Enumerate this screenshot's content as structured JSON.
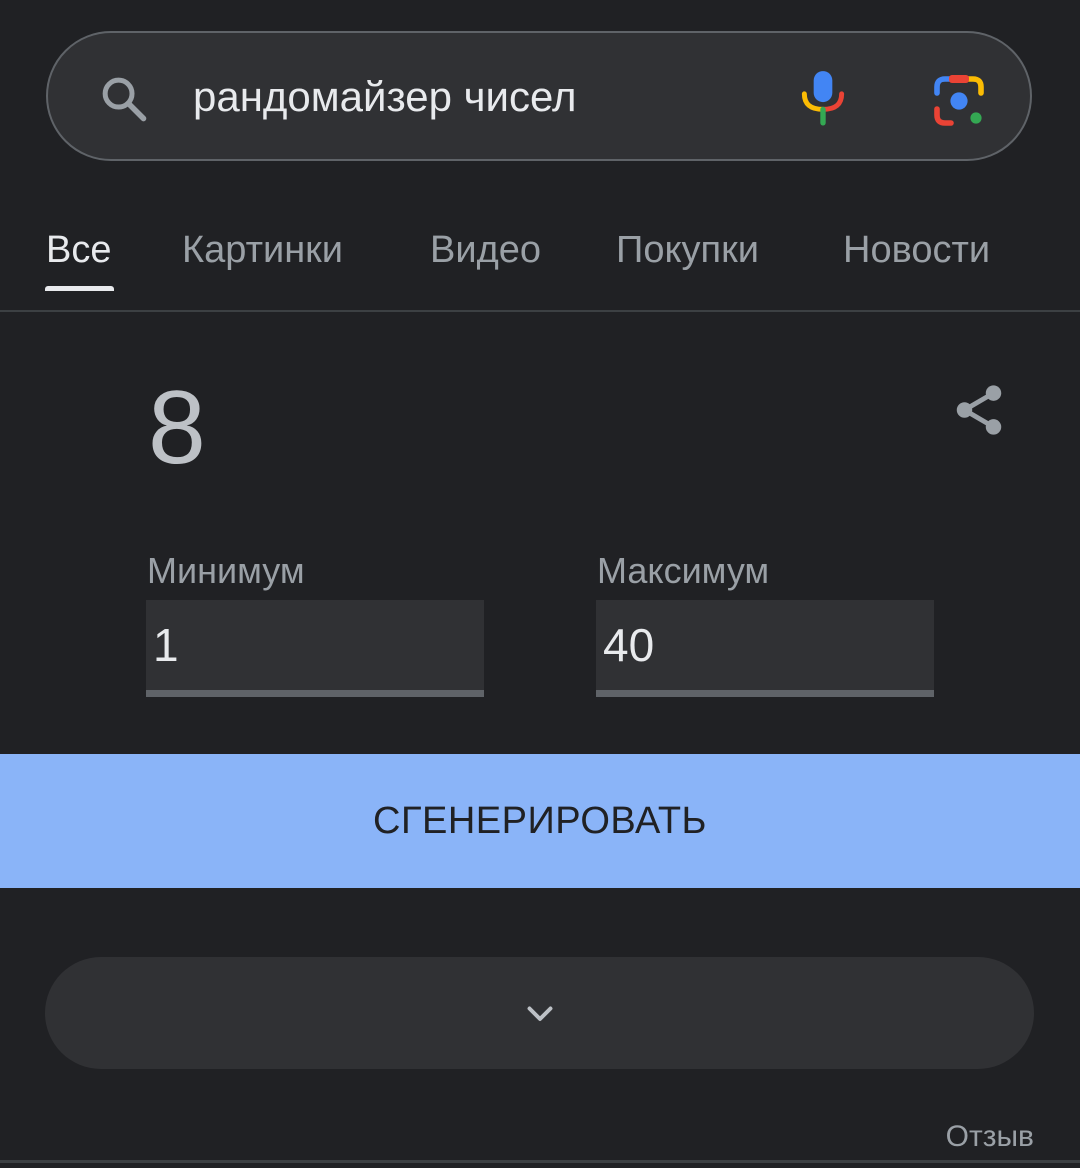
{
  "search": {
    "query": "рандомайзер чисел",
    "icon": "search-icon",
    "voice_icon": "mic-icon",
    "lens_icon": "camera-lens-icon"
  },
  "tabs": [
    {
      "label": "Все",
      "active": true
    },
    {
      "label": "Картинки",
      "active": false
    },
    {
      "label": "Видео",
      "active": false
    },
    {
      "label": "Покупки",
      "active": false
    },
    {
      "label": "Новости",
      "active": false
    }
  ],
  "random_number": {
    "result": "8",
    "share_icon": "share-icon",
    "min_label": "Минимум",
    "min_value": "1",
    "max_label": "Максимум",
    "max_value": "40",
    "generate_label": "СГЕНЕРИРОВАТЬ"
  },
  "expand_icon": "chevron-down-icon",
  "feedback_label": "Отзыв",
  "colors": {
    "background": "#202124",
    "surface": "#303134",
    "accent": "#8ab4f8",
    "text_primary": "#e8eaed",
    "text_secondary": "#9aa0a6"
  }
}
